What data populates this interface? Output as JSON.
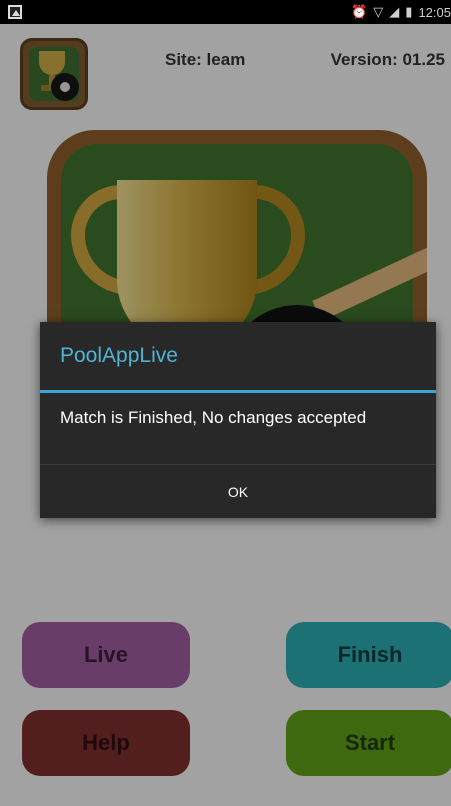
{
  "status_bar": {
    "time": "12:05",
    "icons": [
      "image-icon",
      "alarm-icon",
      "wifi-icon",
      "signal-icon",
      "battery-icon"
    ]
  },
  "header": {
    "site_label": "Site: leam",
    "version_label": "Version: 01.25"
  },
  "dialog": {
    "title": "PoolAppLive",
    "message": "Match is Finished, No changes accepted",
    "ok_label": "OK"
  },
  "buttons": {
    "live": "Live",
    "finish": "Finish",
    "help": "Help",
    "start": "Start"
  },
  "colors": {
    "dialog_accent": "#39a7d3",
    "live": "#9a5a98",
    "finish": "#2aa7ab",
    "help": "#7a2d2d",
    "start": "#5c9b17"
  }
}
